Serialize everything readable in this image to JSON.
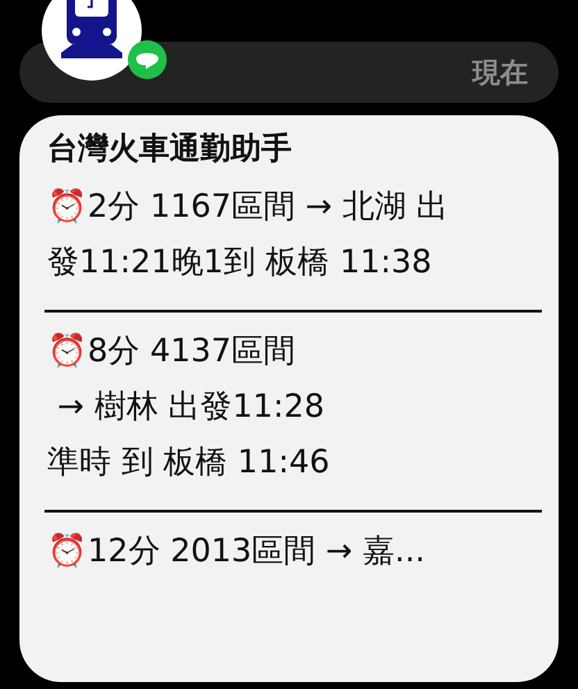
{
  "notification": {
    "time": "現在"
  },
  "message": {
    "title": "台灣火車通勤助手",
    "entries": [
      {
        "lines": [
          "⏰2分 1167區間 → 北湖 出",
          "發11:21晚1到 板橋 11:38"
        ]
      },
      {
        "lines": [
          "⏰8分 4137區間",
          " → 樹林 出發11:28",
          "準時 到 板橋 11:46"
        ]
      },
      {
        "lines": [
          "⏰12分 2013區間 → 嘉..."
        ]
      }
    ]
  }
}
